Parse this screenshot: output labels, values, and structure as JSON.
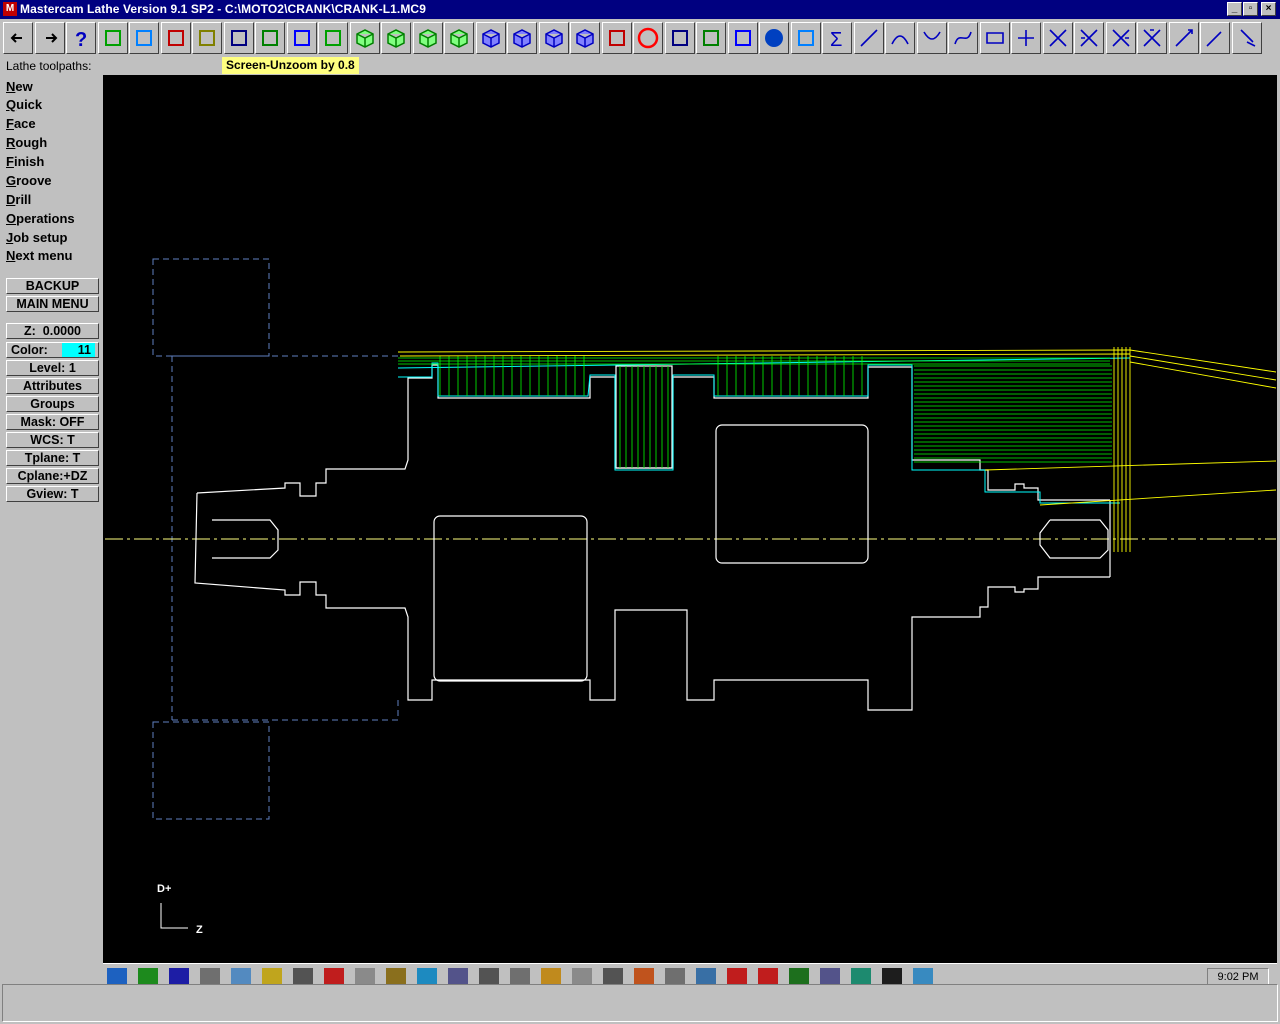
{
  "window": {
    "title": "Mastercam Lathe Version 9.1 SP2 - C:\\MOTO2\\CRANK\\CRANK-L1.MC9",
    "min_glyph": "_",
    "max_glyph": "▫",
    "close_glyph": "×"
  },
  "toolbar": {
    "icons": [
      "arrow-left-icon",
      "arrow-right-icon",
      "help-icon",
      "calculator-icon",
      "analyze-icon",
      "zoom-window-icon",
      "unzoom-icon",
      "zoom-fit-icon",
      "pan-icon",
      "zoom-select-icon",
      "rotate-icon",
      "view-iso-icon",
      "view-top-icon",
      "view-front-icon",
      "view-side-icon",
      "view-cube-icon",
      "view-cube-2-icon",
      "view-cube-3-icon",
      "view-cube-4-icon",
      "eraser-icon",
      "no-delete-icon",
      "transform-icon",
      "translate-icon",
      "undo-icon",
      "sphere-icon",
      "copy-icon",
      "sum-icon",
      "line-icon",
      "arc-icon",
      "fillet-icon",
      "spline-icon",
      "rectangle-icon",
      "point-icon",
      "trim-icon",
      "break-icon",
      "join-icon",
      "extend-icon",
      "line-angle-icon",
      "drill-icon",
      "tool-icon"
    ]
  },
  "prompt": {
    "label": "Lathe toolpaths:",
    "message": "Screen-Unzoom by 0.8"
  },
  "menu": {
    "items": [
      {
        "hot": "N",
        "rest": "ew"
      },
      {
        "hot": "Q",
        "rest": "uick"
      },
      {
        "hot": "F",
        "rest": "ace"
      },
      {
        "hot": "R",
        "rest": "ough"
      },
      {
        "hot": "F",
        "rest": "inish"
      },
      {
        "hot": "G",
        "rest": "roove"
      },
      {
        "hot": "D",
        "rest": "rill"
      },
      {
        "hot": "O",
        "rest": "perations"
      },
      {
        "hot": "J",
        "rest": "ob setup"
      },
      {
        "hot": "N",
        "rest": "ext menu"
      }
    ],
    "backup": "BACKUP",
    "main_menu": "MAIN MENU"
  },
  "status_panel": {
    "z_label": "Z:",
    "z_value": "0.0000",
    "color_label": "Color:",
    "color_value": "11",
    "level": "Level:  1",
    "attributes": "Attributes",
    "groups": "Groups",
    "mask": "Mask:  OFF",
    "wcs": "WCS:   T",
    "tplane": "Tplane:  T",
    "cplane": "Cplane:+DZ",
    "gview": "Gview:   T"
  },
  "axis": {
    "d_label": "D+",
    "z_label": "Z"
  },
  "taskbar": {
    "clock": "9:02 PM"
  },
  "colors": {
    "geometry": "#ffffff",
    "toolpath_green": "#00ff00",
    "toolpath_yellow": "#ffff00",
    "toolpath_cyan": "#00ffff",
    "stock": "#6080c0",
    "title_bg": "#000080"
  }
}
